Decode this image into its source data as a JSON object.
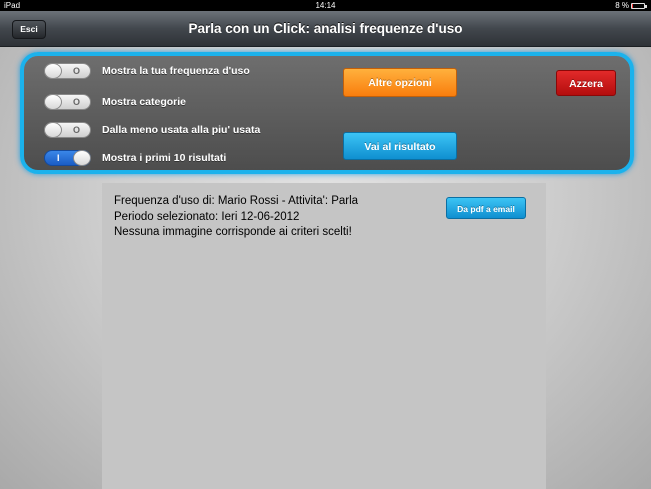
{
  "status_bar": {
    "device": "iPad",
    "time": "14:14",
    "battery": "8 %",
    "battery_level": 0.08
  },
  "nav": {
    "back_label": "Esci",
    "title": "Parla con un Click: analisi frequenze d'uso"
  },
  "options": [
    {
      "label": "Mostra la tua frequenza d'uso",
      "state": "off",
      "mark": "O"
    },
    {
      "label": "Mostra categorie",
      "state": "off",
      "mark": "O"
    },
    {
      "label": "Dalla meno usata alla piu' usata",
      "state": "off",
      "mark": "O"
    },
    {
      "label": "Mostra i primi 10 risultati",
      "state": "on",
      "mark": "I"
    }
  ],
  "buttons": {
    "more_options": "Altre opzioni",
    "reset": "Azzera",
    "go_result": "Vai al risultato",
    "pdf_email": "Da pdf a email"
  },
  "result": {
    "line1": "Frequenza d'uso di: Mario Rossi - Attivita': Parla",
    "line2": "Periodo selezionato: Ieri 12-06-2012",
    "line3": "Nessuna immagine corrisponde ai criteri scelti!"
  },
  "colors": {
    "accent_blue": "#1bb2ec",
    "orange": "#f97d0d",
    "red": "#c41414"
  }
}
